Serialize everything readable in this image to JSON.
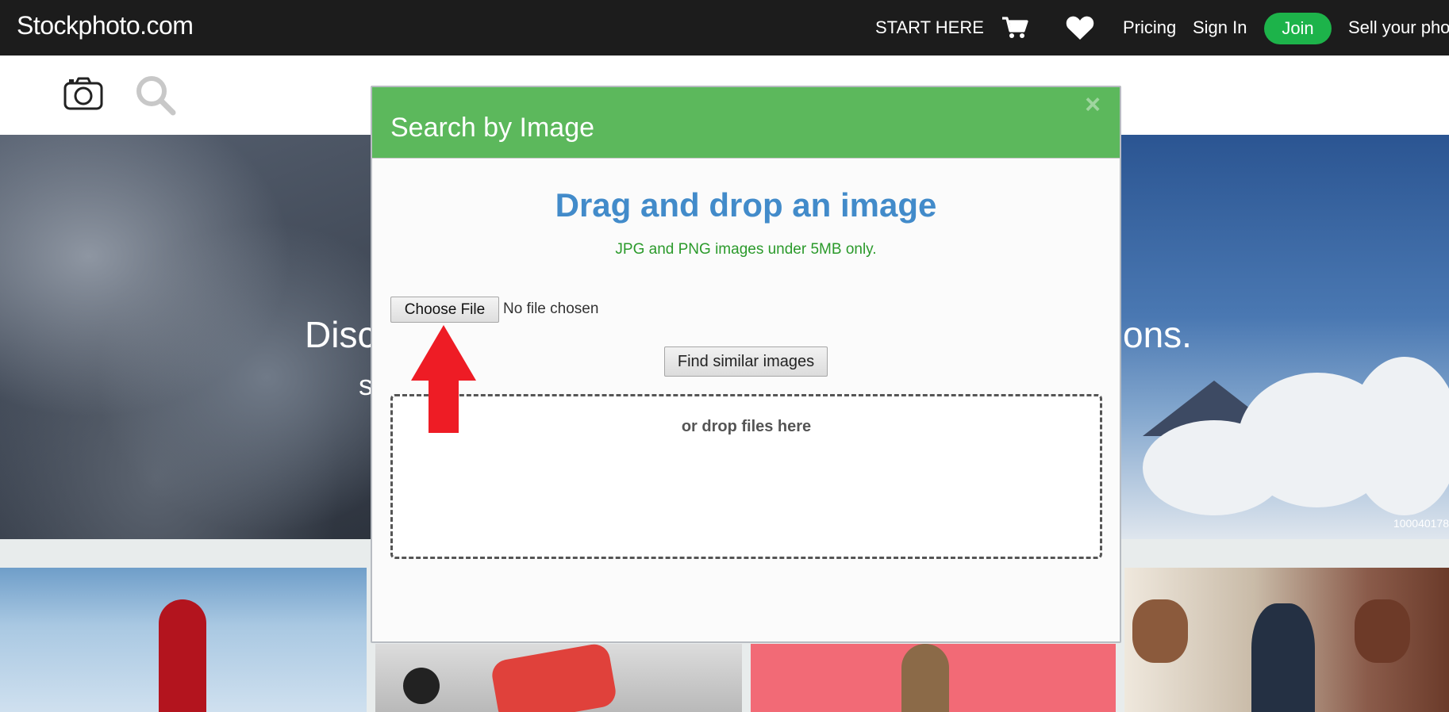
{
  "header": {
    "logo": "Stockphoto.com",
    "start_here": "START HERE",
    "cart_icon": "shopping-cart-icon",
    "heart_icon": "heart-icon",
    "pricing": "Pricing",
    "sign_in": "Sign In",
    "join": "Join",
    "sell": "Sell your pho",
    "join_color": "#1db34a"
  },
  "search_row": {
    "camera_icon": "camera-icon",
    "search_icon": "search-icon"
  },
  "hero": {
    "text_left": "Disc",
    "text_left2": "s",
    "text_right": "ons.",
    "image_id": "100040178"
  },
  "modal": {
    "title": "Search by Image",
    "close": "×",
    "drag_title": "Drag and drop an image",
    "drag_subtitle": "JPG and PNG images under 5MB only.",
    "choose_file": "Choose File",
    "file_status": "No file chosen",
    "find_button": "Find similar images",
    "drop_label": "or drop files here",
    "header_color": "#5cb85c",
    "title_color": "#428bca",
    "subtitle_color": "#2b9a2b"
  },
  "annotation": {
    "arrow_icon": "red-up-arrow-icon",
    "color": "#ee1c25"
  }
}
